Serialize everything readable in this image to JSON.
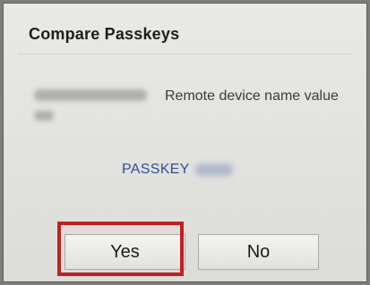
{
  "dialog": {
    "title": "Compare Passkeys",
    "device_description": "Remote device name value",
    "passkey_label": "PASSKEY"
  },
  "buttons": {
    "yes_label": "Yes",
    "no_label": "No"
  },
  "colors": {
    "highlight": "#c21f22",
    "passkey_text": "#2f4f97"
  }
}
